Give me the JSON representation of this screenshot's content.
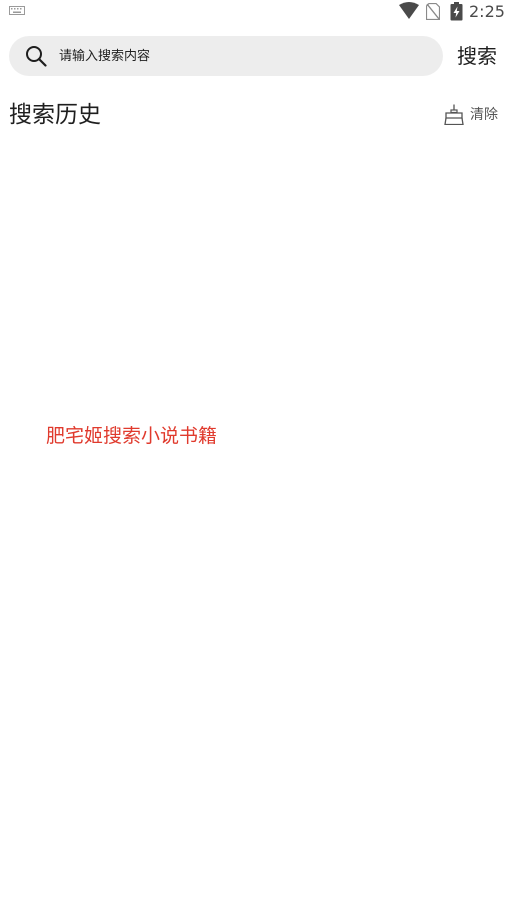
{
  "status_bar": {
    "time": "2:25",
    "icons": [
      "keyboard-icon",
      "wifi-icon",
      "no-sim-icon",
      "battery-charging-icon"
    ]
  },
  "search": {
    "placeholder": "请输入搜索内容",
    "value": "",
    "button_label": "搜索",
    "icon": "search-icon"
  },
  "history": {
    "title": "搜索历史",
    "clear_label": "清除",
    "clear_icon": "broom-icon"
  },
  "promo": {
    "text": "肥宅姬搜索小说书籍",
    "color": "#e03a2d"
  },
  "colors": {
    "search_bg": "#ededed",
    "background": "#ffffff"
  }
}
